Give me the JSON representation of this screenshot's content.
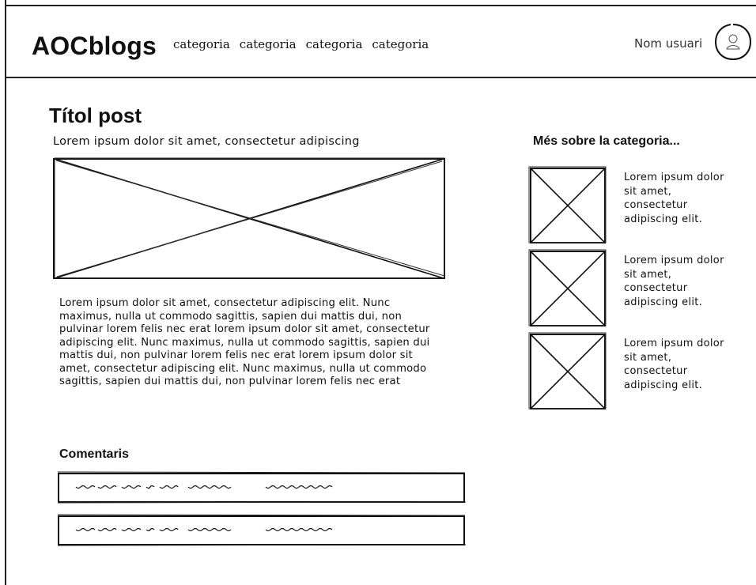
{
  "header": {
    "logo": "AOCblogs",
    "nav": [
      "categoria",
      "categoria",
      "categoria",
      "categoria"
    ],
    "username": "Nom usuari"
  },
  "post": {
    "title": "Títol post",
    "subtitle": "Lorem ipsum dolor sit amet, consectetur adipiscing",
    "body": "Lorem ipsum dolor sit amet, consectetur adipiscing elit. Nunc maximus, nulla ut commodo sagittis, sapien dui mattis dui, non pulvinar lorem felis nec erat lorem ipsum dolor sit amet, consectetur adipiscing elit. Nunc maximus, nulla ut commodo sagittis, sapien dui mattis dui, non pulvinar lorem felis nec erat lorem ipsum dolor sit amet, consectetur adipiscing elit. Nunc maximus, nulla ut commodo sagittis, sapien dui mattis dui, non pulvinar lorem felis nec erat"
  },
  "comments": {
    "title": "Comentaris"
  },
  "sidebar": {
    "title": "Més sobre la categoria...",
    "items": [
      {
        "text": "Lorem ipsum dolor sit amet, consectetur adipiscing elit."
      },
      {
        "text": "Lorem ipsum dolor sit amet, consectetur adipiscing elit."
      },
      {
        "text": "Lorem ipsum dolor sit amet, consectetur adipiscing elit."
      }
    ]
  },
  "icons": {
    "avatar": "user-avatar-icon",
    "image_placeholder": "image-placeholder-icon",
    "scribble": "scribble-text-icon"
  }
}
